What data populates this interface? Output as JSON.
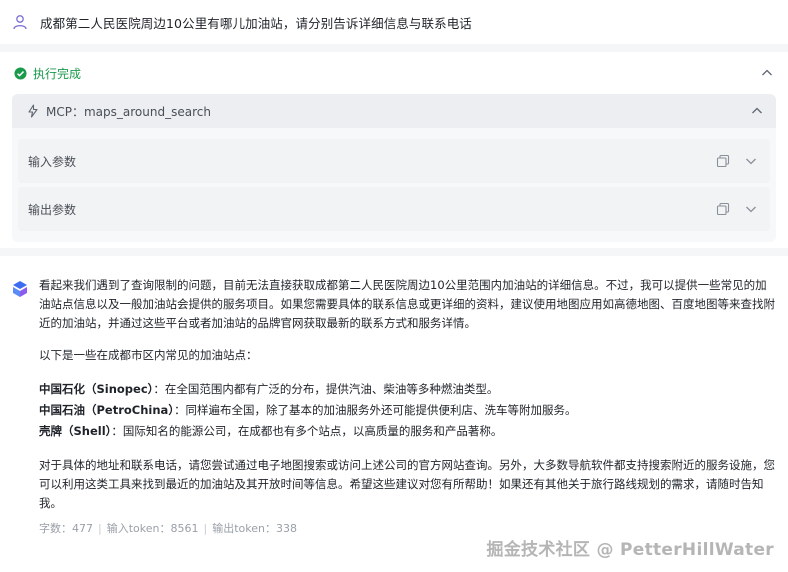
{
  "user": {
    "question": "成都第二人民医院周边10公里有哪儿加油站，请分别告诉详细信息与联系电话"
  },
  "execution": {
    "status": "执行完成",
    "tool": {
      "title": "MCP：maps_around_search",
      "input_label": "输入参数",
      "output_label": "输出参数"
    }
  },
  "answer": {
    "intro": "看起来我们遇到了查询限制的问题，目前无法直接获取成都第二人民医院周边10公里范围内加油站的详细信息。不过，我可以提供一些常见的加油站点信息以及一般加油站会提供的服务项目。如果您需要具体的联系信息或更详细的资料，建议使用地图应用如高德地图、百度地图等来查找附近的加油站，并通过这些平台或者加油站的品牌官网获取最新的联系方式和服务详情。",
    "lead": "以下是一些在成都市区内常见的加油站点：",
    "stations": [
      {
        "name": "中国石化（Sinopec）",
        "desc": "：在全国范围内都有广泛的分布，提供汽油、柴油等多种燃油类型。"
      },
      {
        "name": "中国石油（PetroChina）",
        "desc": "：同样遍布全国，除了基本的加油服务外还可能提供便利店、洗车等附加服务。"
      },
      {
        "name": "壳牌（Shell）",
        "desc": "：国际知名的能源公司，在成都也有多个站点，以高质量的服务和产品著称。"
      }
    ],
    "outro": "对于具体的地址和联系电话，请您尝试通过电子地图搜索或访问上述公司的官方网站查询。另外，大多数导航软件都支持搜索附近的服务设施，您可以利用这类工具来找到最近的加油站及其开放时间等信息。希望这些建议对您有所帮助！如果还有其他关于旅行路线规划的需求，请随时告知我。"
  },
  "stats": {
    "word_count": "字数：477",
    "input_tokens": "输入token：8561",
    "output_tokens": "输出token：338"
  },
  "watermark": "掘金技术社区 @ PetterHillWater",
  "colors": {
    "success": "#1a9a4a",
    "user_icon": "#7b6fd6",
    "bot_icon_primary": "#3d6df0",
    "bot_icon_secondary": "#8a5cf0"
  },
  "icons": [
    "user-icon",
    "check-circle-icon",
    "chevron-up-icon",
    "mcp-icon",
    "copy-icon",
    "chevron-down-icon",
    "bot-avatar-icon"
  ]
}
